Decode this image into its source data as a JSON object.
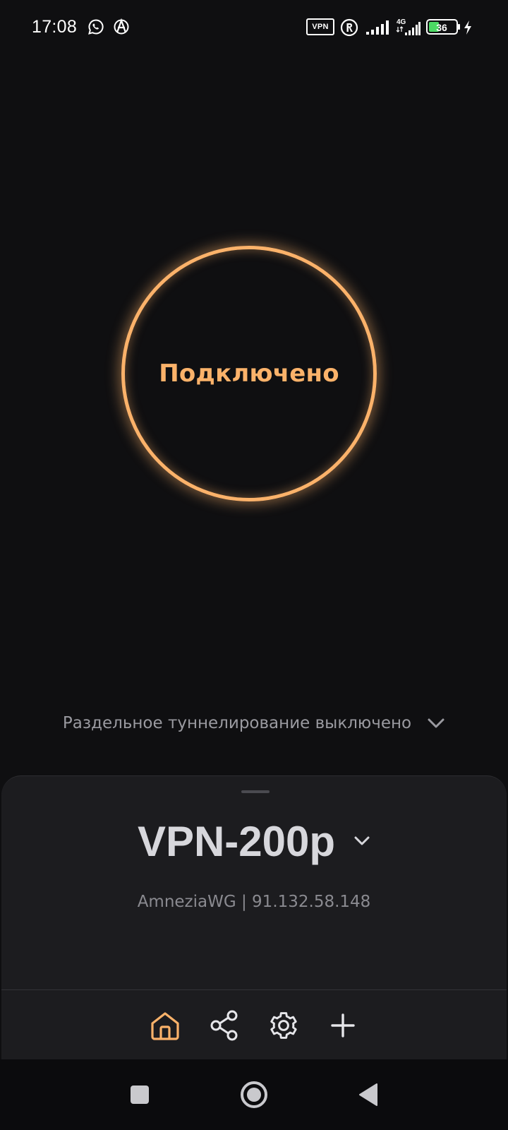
{
  "status_bar": {
    "time": "17:08",
    "vpn_badge": "VPN",
    "network_type": "4G",
    "battery": "36",
    "icons": [
      "whatsapp-icon",
      "anarchy-icon",
      "vpn-icon",
      "roaming-icon",
      "signal-icon",
      "signal-4g-icon",
      "battery-icon",
      "charging-icon"
    ]
  },
  "connect": {
    "status": "Подключено",
    "accent_color": "#fbb26a"
  },
  "split_tunnel": {
    "label": "Раздельное туннелирование выключено",
    "icon": "chevron-down-icon"
  },
  "server": {
    "name": "VPN-200p",
    "info": "AmneziaWG | 91.132.58.148"
  },
  "tabs": [
    {
      "id": "home",
      "icon": "home-icon",
      "active": true
    },
    {
      "id": "share",
      "icon": "share-icon",
      "active": false
    },
    {
      "id": "settings",
      "icon": "gear-icon",
      "active": false
    },
    {
      "id": "add",
      "icon": "plus-icon",
      "active": false
    }
  ],
  "colors": {
    "background": "#0f0f11",
    "sheet": "#1c1c1f",
    "accent": "#fbb26a",
    "muted_text": "#8a8a90"
  }
}
